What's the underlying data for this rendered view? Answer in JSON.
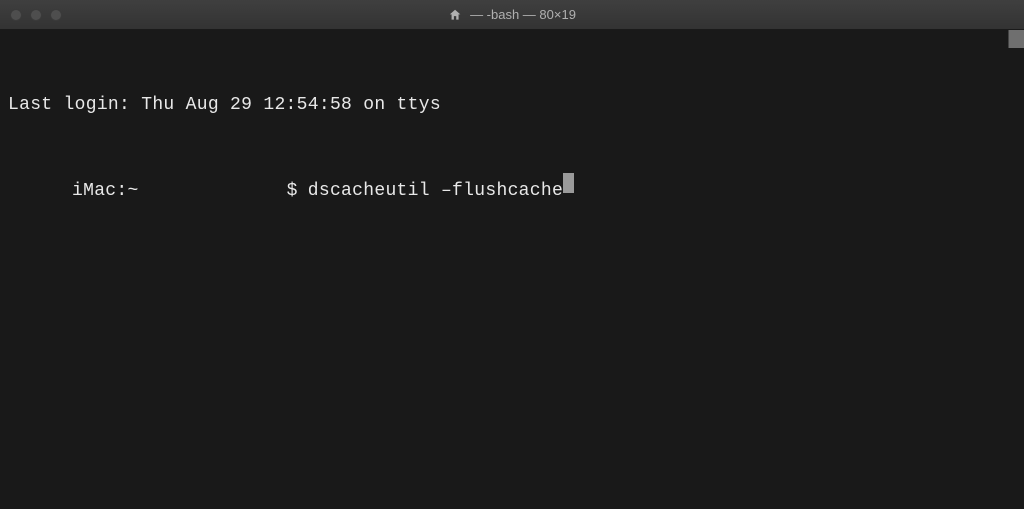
{
  "titlebar": {
    "icon": "home-icon",
    "title": "— -bash — 80×19"
  },
  "terminal": {
    "last_login": "Last login: Thu Aug 29 12:54:58 on ttys",
    "prompt_host": "iMac:~",
    "prompt_sign": "$",
    "command": "dscacheutil –flushcache"
  }
}
